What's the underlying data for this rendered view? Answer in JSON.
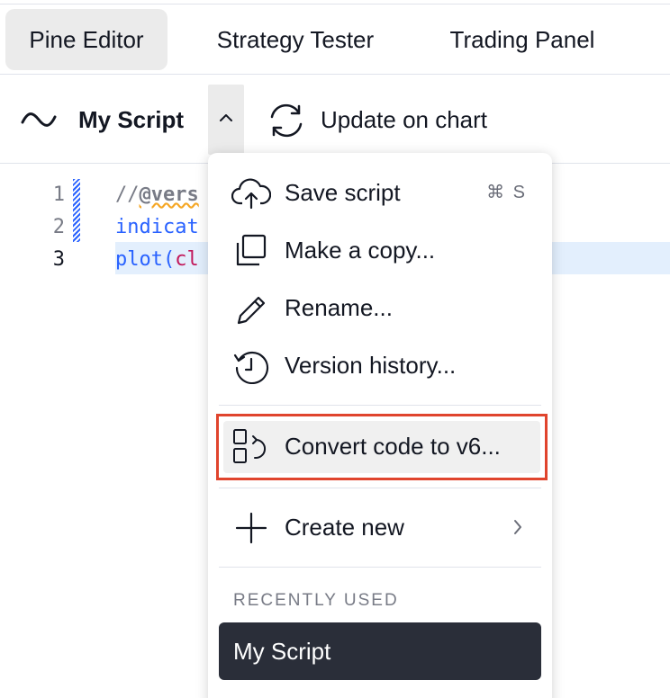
{
  "tabs": [
    {
      "label": "Pine Editor",
      "active": true
    },
    {
      "label": "Strategy Tester",
      "active": false
    },
    {
      "label": "Trading Panel",
      "active": false
    }
  ],
  "toolbar": {
    "script_name": "My Script",
    "update_label": "Update on chart"
  },
  "editor": {
    "line_numbers": [
      "1",
      "2",
      "3"
    ],
    "current_line": 3,
    "lines": [
      {
        "prefix": "//",
        "annotation": "@vers"
      },
      {
        "keyword": "indicat"
      },
      {
        "keyword": "plot(",
        "rest": "cl"
      }
    ]
  },
  "menu": {
    "items": [
      {
        "label": "Save script",
        "shortcut": "⌘ S",
        "icon": "cloud-upload-icon"
      },
      {
        "label": "Make a copy...",
        "icon": "copy-icon"
      },
      {
        "label": "Rename...",
        "icon": "pencil-icon"
      },
      {
        "label": "Version history...",
        "icon": "history-icon"
      },
      {
        "label": "Convert code to v6...",
        "icon": "convert-icon",
        "highlighted": true
      },
      {
        "label": "Create new",
        "icon": "plus-icon",
        "has_submenu": true
      }
    ],
    "recent_title": "RECENTLY USED",
    "recent_items": [
      "My Script"
    ]
  },
  "colors": {
    "accent": "#2962ff",
    "highlight_border": "#e0442d",
    "recent_bg": "#2a2e39"
  }
}
